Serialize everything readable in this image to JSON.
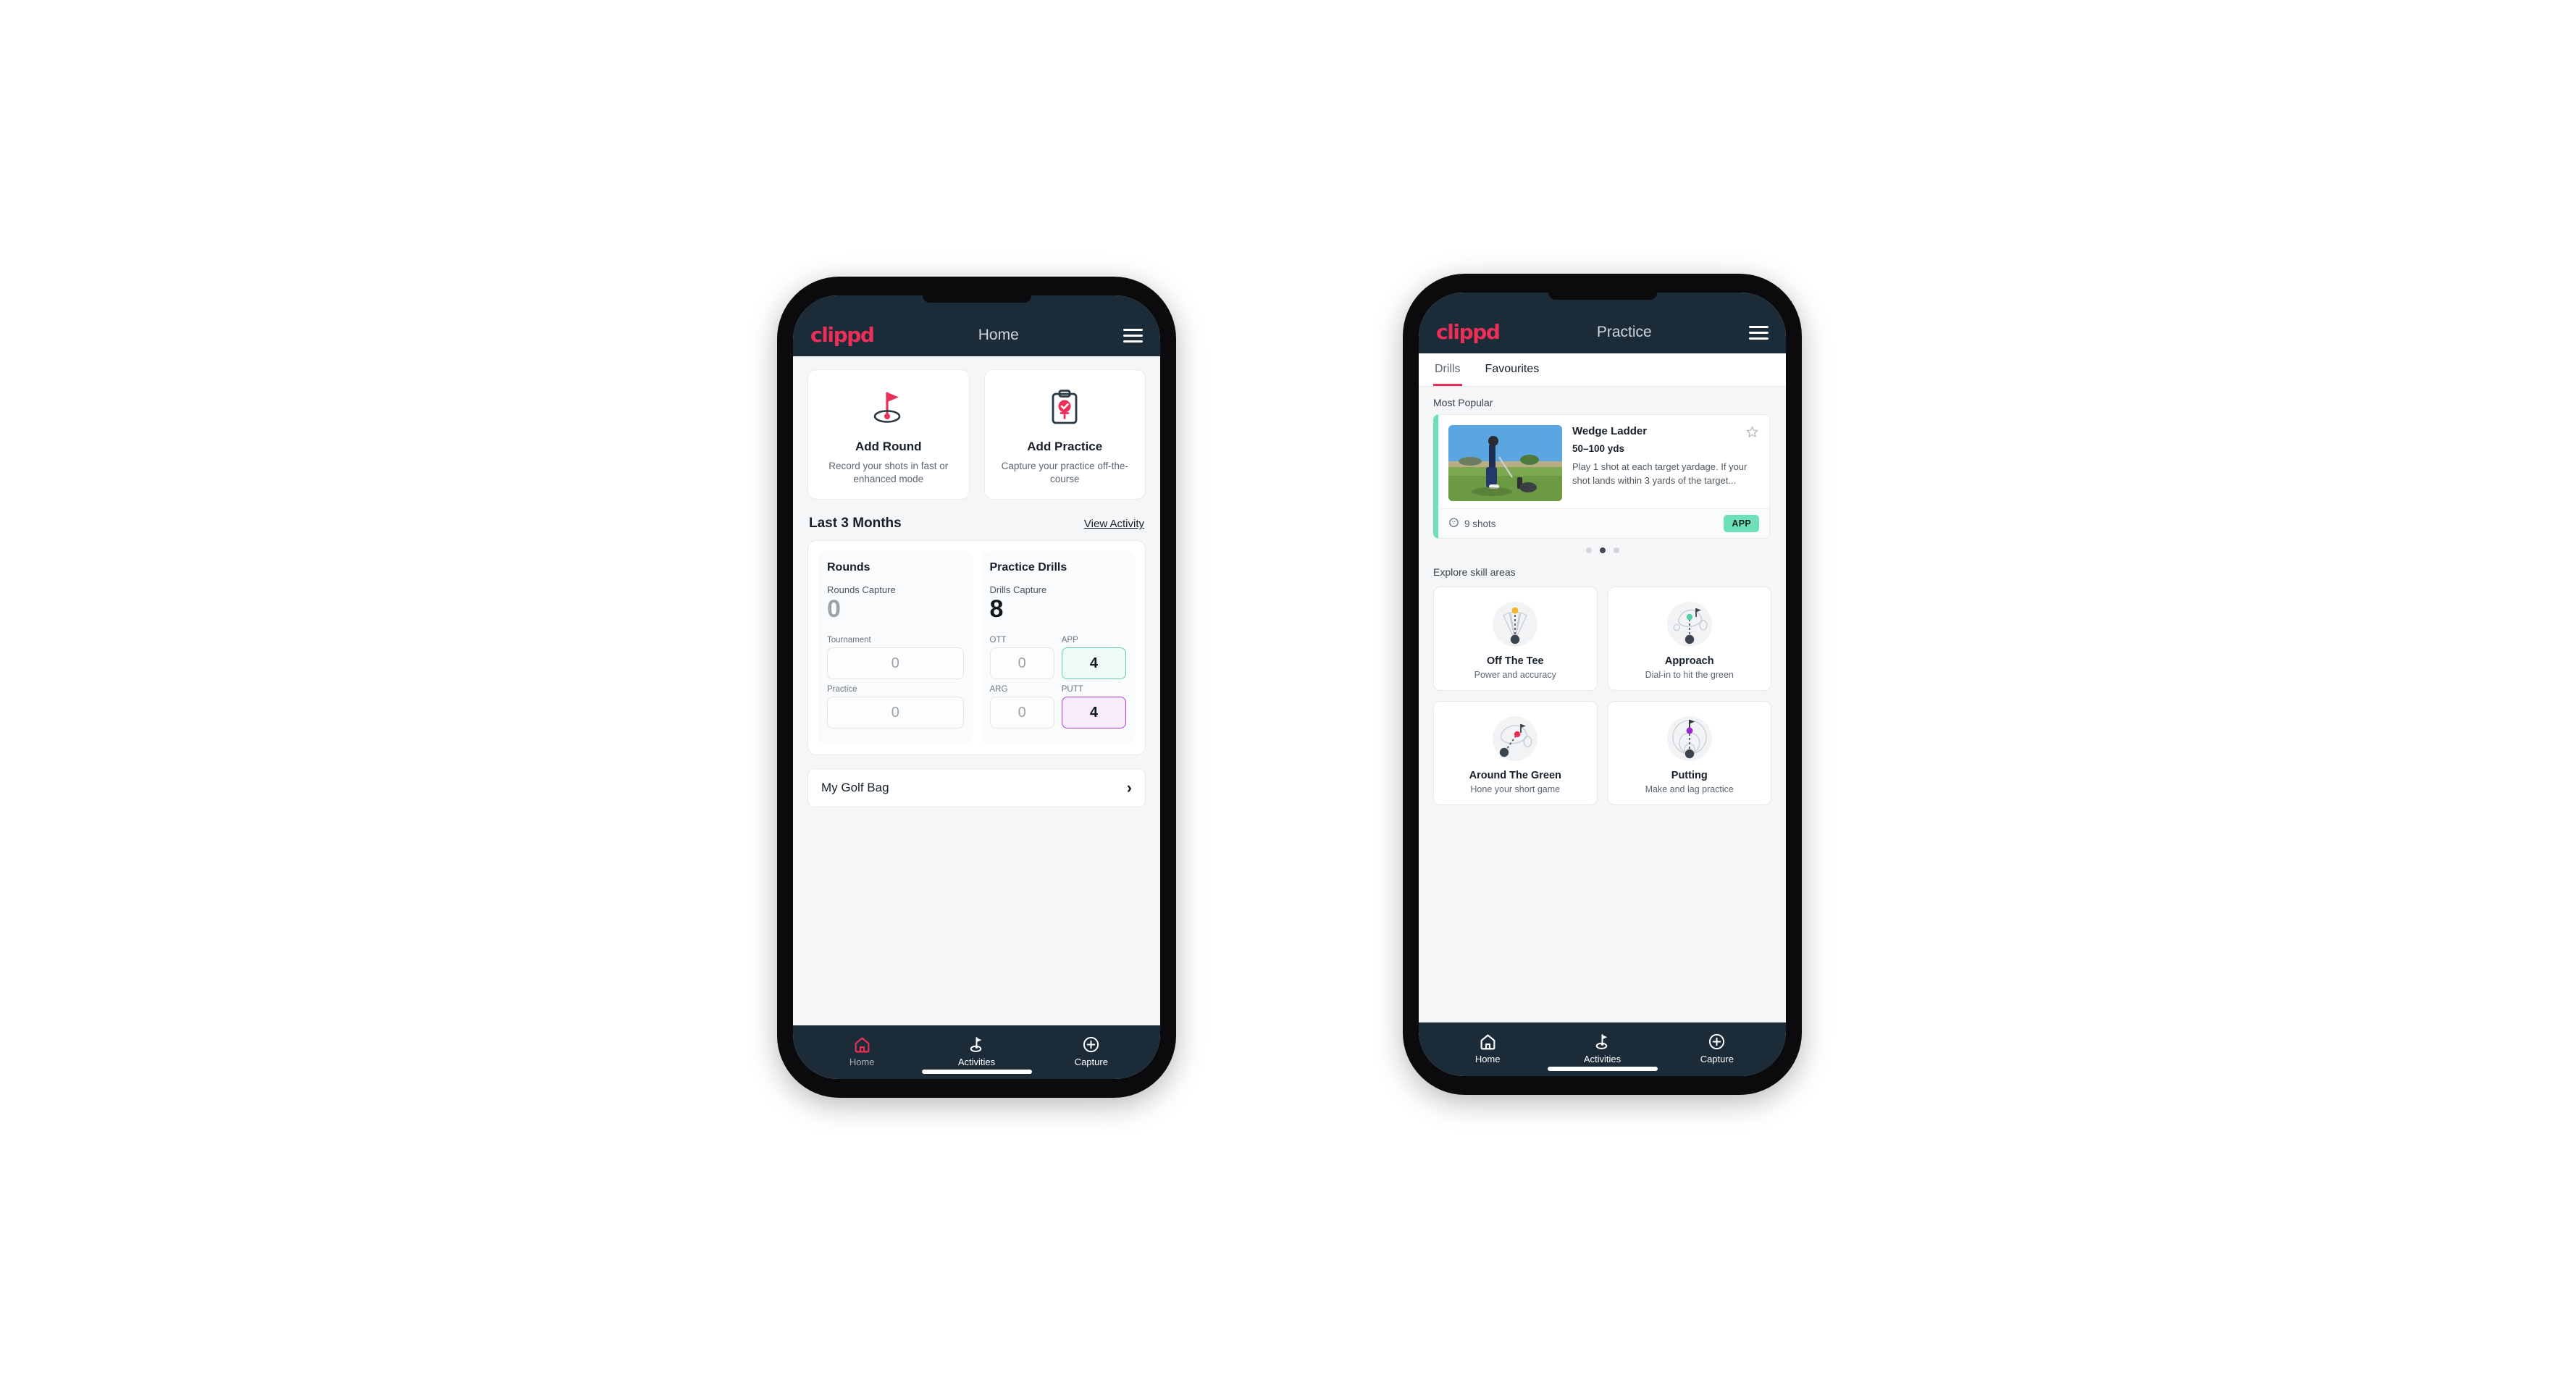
{
  "brand": {
    "logo_text": "clippd",
    "accent_pink": "#ec2f57",
    "header_navy": "#1b2b38",
    "mint": "#6ee0b8",
    "purple": "#9b27d4"
  },
  "phone_home": {
    "appbar": {
      "title": "Home",
      "menu_icon": "hamburger-icon"
    },
    "quick_actions": [
      {
        "icon": "golf-flag-hole-icon",
        "title": "Add Round",
        "subtitle": "Record your shots in fast or enhanced mode"
      },
      {
        "icon": "clipboard-check-icon",
        "title": "Add Practice",
        "subtitle": "Capture your practice off-the-course"
      }
    ],
    "section": {
      "title": "Last 3 Months",
      "link": "View Activity"
    },
    "rounds": {
      "heading": "Rounds",
      "capture_label": "Rounds Capture",
      "capture_value": "0",
      "minis": [
        {
          "label": "Tournament",
          "value": "0",
          "state": "plain"
        },
        {
          "label": "Practice",
          "value": "0",
          "state": "plain"
        }
      ]
    },
    "drills": {
      "heading": "Practice Drills",
      "capture_label": "Drills Capture",
      "capture_value": "8",
      "minis": [
        {
          "label": "OTT",
          "value": "0",
          "state": "plain"
        },
        {
          "label": "APP",
          "value": "4",
          "state": "green"
        },
        {
          "label": "ARG",
          "value": "0",
          "state": "plain"
        },
        {
          "label": "PUTT",
          "value": "4",
          "state": "purple"
        }
      ]
    },
    "golf_bag": {
      "label": "My Golf Bag",
      "chevron": "›"
    },
    "bottom_nav": [
      {
        "icon": "home-icon",
        "label": "Home",
        "active": true
      },
      {
        "icon": "golf-flag-icon",
        "label": "Activities",
        "active": false
      },
      {
        "icon": "plus-circle-icon",
        "label": "Capture",
        "active": false
      }
    ]
  },
  "phone_practice": {
    "appbar": {
      "title": "Practice",
      "menu_icon": "hamburger-icon"
    },
    "tabs": [
      {
        "label": "Drills",
        "active": true
      },
      {
        "label": "Favourites",
        "active": false
      }
    ],
    "most_popular_label": "Most Popular",
    "drill_card": {
      "thumb_alt": "golfer-hitting-wedge-photo",
      "title": "Wedge Ladder",
      "range": "50–100 yds",
      "description": "Play 1 shot at each target yardage. If your shot lands within 3 yards of the target...",
      "shots": "9 shots",
      "shots_icon": "golf-ball-icon",
      "favourite_icon": "star-outline-icon",
      "badge": "APP"
    },
    "carousel_dots": {
      "count": 3,
      "active_index": 1
    },
    "explore_label": "Explore skill areas",
    "skill_areas": [
      {
        "icon": "tee-fan-icon",
        "name": "Off The Tee",
        "subtitle": "Power and accuracy"
      },
      {
        "icon": "green-approach-icon",
        "name": "Approach",
        "subtitle": "Dial-in to hit the green"
      },
      {
        "icon": "chip-green-icon",
        "name": "Around The Green",
        "subtitle": "Hone your short game"
      },
      {
        "icon": "putting-rings-icon",
        "name": "Putting",
        "subtitle": "Make and lag practice"
      }
    ],
    "bottom_nav": [
      {
        "icon": "home-icon",
        "label": "Home",
        "active": false
      },
      {
        "icon": "golf-flag-icon",
        "label": "Activities",
        "active": false
      },
      {
        "icon": "plus-circle-icon",
        "label": "Capture",
        "active": false
      }
    ]
  }
}
